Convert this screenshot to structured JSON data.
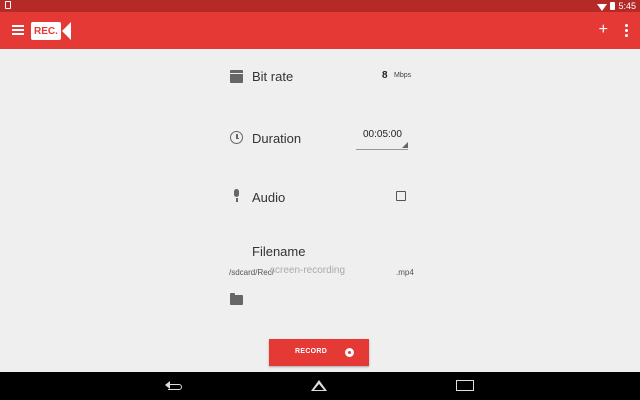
{
  "status_bar": {
    "time": "5:45"
  },
  "app_bar": {
    "logo_text": "REC.",
    "add_symbol": "+"
  },
  "settings": {
    "bitrate": {
      "label": "Bit rate",
      "value": "8",
      "unit": "Mbps"
    },
    "duration": {
      "label": "Duration",
      "value": "00:05:00"
    },
    "audio": {
      "label": "Audio",
      "checked": false
    },
    "filename": {
      "label": "Filename",
      "prefix": "/sdcard/Rec/",
      "placeholder": "screen-recording",
      "extension": ".mp4"
    }
  },
  "record_button": {
    "label": "RECORD"
  },
  "colors": {
    "primary": "#e53935",
    "status_bar": "#b52a27",
    "background": "#efefef"
  }
}
